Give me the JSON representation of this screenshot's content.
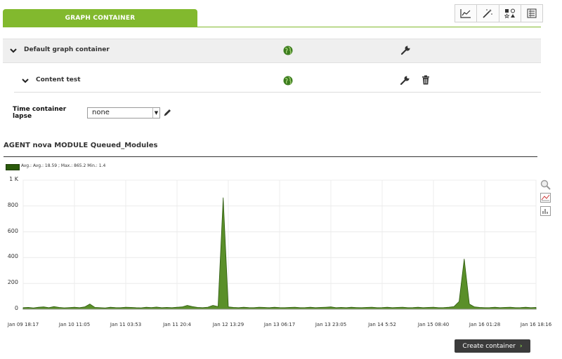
{
  "tab": {
    "label": "GRAPH CONTAINER"
  },
  "toolbar": {
    "icons": [
      "line-chart-icon",
      "wand-icon",
      "shapes-icon",
      "list-icon"
    ]
  },
  "containers": [
    {
      "label": "Default graph container"
    },
    {
      "label": "Content test"
    }
  ],
  "time_lapse": {
    "label": "Time container lapse",
    "value": "none"
  },
  "graph": {
    "title": "AGENT nova MODULE Queued_Modules",
    "legend": "Avg.: Avg.: 18.59 ; Max.: 865.2   Min.: 1.4",
    "color": "#5a8f29"
  },
  "chart_data": {
    "type": "area",
    "title": "AGENT nova MODULE Queued_Modules",
    "ylim": [
      0,
      1000
    ],
    "yticks": [
      "0",
      "200",
      "400",
      "600",
      "800",
      "1 K"
    ],
    "xticks": [
      "Jan 09 18:17",
      "Jan 10 11:05",
      "Jan 11 03:53",
      "Jan 11 20:4",
      "Jan 12 13:29",
      "Jan 13 06:17",
      "Jan 13 23:05",
      "Jan 14  5:52",
      "Jan 15 08:40",
      "Jan 16 01:28",
      "Jan 16 18:16"
    ],
    "series": [
      {
        "name": "Avg.: 18.59 ; Max.: 865.2   Min.: 1.4",
        "x": [
          0,
          1,
          2,
          3,
          4,
          5,
          6,
          7,
          8,
          9,
          10,
          11,
          12,
          13,
          14,
          15,
          16,
          17,
          18,
          19,
          20,
          21,
          22,
          23,
          24,
          25,
          26,
          27,
          28,
          29,
          30,
          31,
          32,
          33,
          34,
          35,
          36,
          37,
          38,
          39,
          40,
          41,
          42,
          43,
          44,
          45,
          46,
          47,
          48,
          49,
          50,
          51,
          52,
          53,
          54,
          55,
          56,
          57,
          58,
          59,
          60,
          61,
          62,
          63,
          64,
          65,
          66,
          67,
          68,
          69,
          70,
          71,
          72,
          73,
          74,
          75,
          76,
          77,
          78,
          79,
          80,
          81,
          82,
          83,
          84,
          85,
          86,
          87,
          88,
          89,
          90,
          91,
          92,
          93,
          94,
          95,
          96,
          97,
          98,
          99,
          100
        ],
        "values": [
          12,
          14,
          10,
          15,
          18,
          12,
          20,
          14,
          11,
          13,
          16,
          12,
          18,
          40,
          14,
          12,
          10,
          15,
          13,
          12,
          16,
          14,
          12,
          11,
          15,
          13,
          17,
          12,
          14,
          12,
          15,
          18,
          30,
          20,
          14,
          12,
          16,
          30,
          20,
          865,
          18,
          14,
          12,
          15,
          13,
          12,
          16,
          14,
          12,
          15,
          13,
          12,
          14,
          16,
          12,
          13,
          15,
          12,
          14,
          16,
          18,
          12,
          14,
          12,
          15,
          13,
          12,
          14,
          16,
          12,
          13,
          15,
          12,
          14,
          16,
          12,
          13,
          15,
          12,
          14,
          16,
          12,
          13,
          15,
          20,
          60,
          390,
          40,
          18,
          14,
          12,
          13,
          15,
          12,
          14,
          16,
          12,
          13,
          15,
          12,
          14
        ]
      }
    ]
  },
  "button": {
    "label": "Create container"
  }
}
